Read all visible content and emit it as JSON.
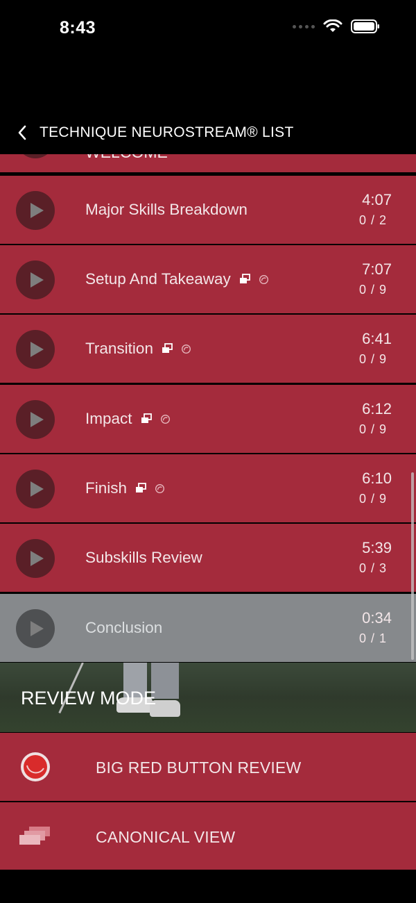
{
  "status_bar": {
    "time": "8:43"
  },
  "nav": {
    "title": "TECHNIQUE NEUROSTREAM® LIST"
  },
  "list": {
    "partial_item_title": "WELCOME",
    "items": [
      {
        "title": "Major Skills Breakdown",
        "duration": "4:07",
        "progress": "0 / 2",
        "icons": false,
        "dimmed": false
      },
      {
        "title": "Setup And Takeaway",
        "duration": "7:07",
        "progress": "0 / 9",
        "icons": true,
        "dimmed": false
      },
      {
        "title": "Transition",
        "duration": "6:41",
        "progress": "0 / 9",
        "icons": true,
        "dimmed": false
      },
      {
        "title": "Impact",
        "duration": "6:12",
        "progress": "0 / 9",
        "icons": true,
        "dimmed": false
      },
      {
        "title": "Finish",
        "duration": "6:10",
        "progress": "0 / 9",
        "icons": true,
        "dimmed": false
      },
      {
        "title": "Subskills Review",
        "duration": "5:39",
        "progress": "0 / 3",
        "icons": false,
        "dimmed": false
      },
      {
        "title": "Conclusion",
        "duration": "0:34",
        "progress": "0 / 1",
        "icons": false,
        "dimmed": true
      }
    ]
  },
  "review": {
    "title": "REVIEW MODE",
    "big_red_button_label": "BIG RED BUTTON REVIEW",
    "canonical_view_label": "CANONICAL VIEW"
  },
  "icons": {
    "play": "play-icon",
    "stack": "stack-icon",
    "spiral": "spiral-icon"
  },
  "colors": {
    "row_background": "#a42b3c",
    "row_dimmed": "#86898c",
    "play_button": "#5a1f27"
  }
}
